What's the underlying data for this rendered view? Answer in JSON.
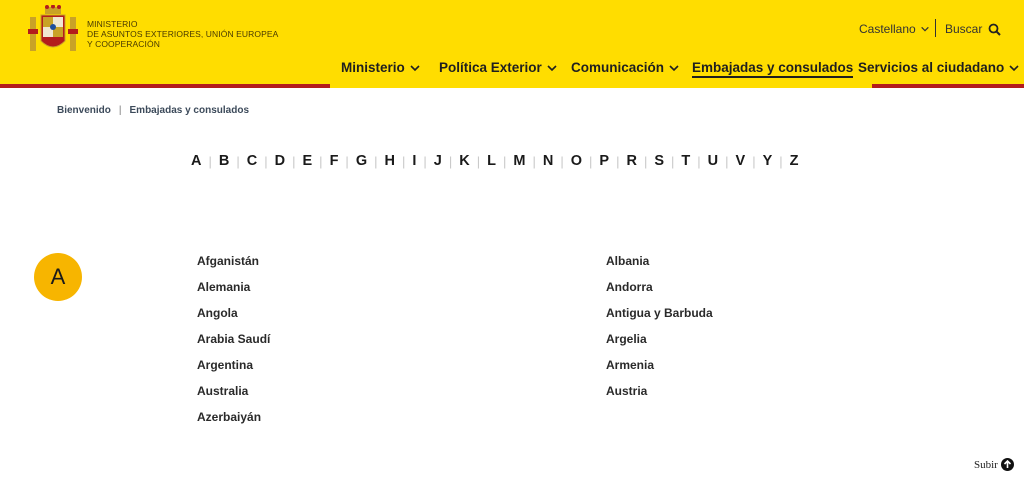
{
  "header": {
    "ministry_lines": [
      "MINISTERIO",
      "DE ASUNTOS EXTERIORES, UNIÓN EUROPEA",
      "Y COOPERACIÓN"
    ],
    "language": "Castellano",
    "search_label": "Buscar",
    "nav": [
      {
        "label": "Ministerio"
      },
      {
        "label": "Política Exterior"
      },
      {
        "label": "Comunicación"
      },
      {
        "label": "Embajadas y consulados"
      },
      {
        "label": "Servicios al ciudadano"
      }
    ]
  },
  "breadcrumb": [
    "Bienvenido",
    "Embajadas y consulados"
  ],
  "alphabet": [
    "A",
    "B",
    "C",
    "D",
    "E",
    "F",
    "G",
    "H",
    "I",
    "J",
    "K",
    "L",
    "M",
    "N",
    "O",
    "P",
    "R",
    "S",
    "T",
    "U",
    "V",
    "Y",
    "Z"
  ],
  "section": {
    "letter": "A",
    "left": [
      "Afganistán",
      "Alemania",
      "Angola",
      "Arabia Saudí",
      "Argentina",
      "Australia",
      "Azerbaiyán"
    ],
    "right": [
      "Albania",
      "Andorra",
      "Antigua y Barbuda",
      "Argelia",
      "Armenia",
      "Austria"
    ]
  },
  "footer": {
    "subir_label": "Subir"
  },
  "colors": {
    "brand_yellow": "#ffdd00",
    "brand_red": "#b31c1c",
    "circle_yellow": "#f7b500"
  }
}
